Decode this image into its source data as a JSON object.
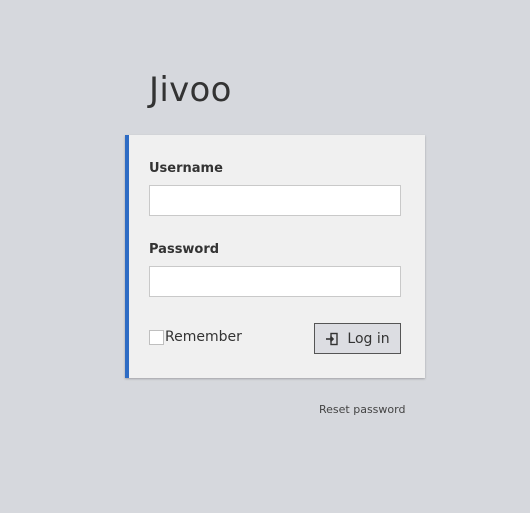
{
  "app": {
    "title": "Jivoo"
  },
  "login_form": {
    "username_label": "Username",
    "username_value": "",
    "password_label": "Password",
    "password_value": "",
    "remember_label": "Remember",
    "remember_checked": false,
    "login_button_label": "Log in",
    "login_button_icon": "sign-in-icon"
  },
  "links": {
    "reset_password": "Reset password"
  },
  "colors": {
    "background": "#d6d8dd",
    "panel": "#f0f0f0",
    "accent": "#2e6cc4"
  }
}
